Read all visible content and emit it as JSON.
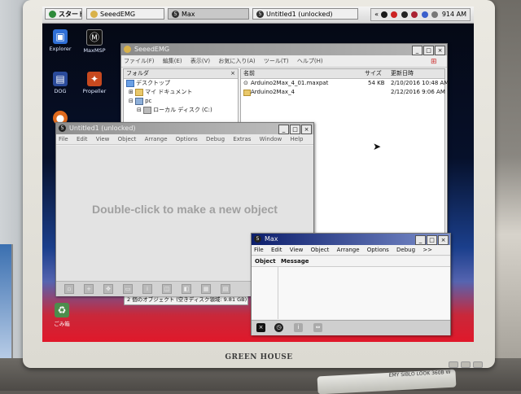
{
  "taskbar": {
    "start_label": "スタート",
    "items": [
      {
        "label": "SeeedEMG"
      },
      {
        "label": "Max"
      },
      {
        "label": "Untitled1 (unlocked)"
      }
    ],
    "tray_chevron": "«",
    "clock": "914 AM"
  },
  "desktop_icons": [
    {
      "label": "Explorer",
      "icon": "explorer-icon"
    },
    {
      "label": "MaxMSP",
      "icon": "max-icon"
    },
    {
      "label": "DOG",
      "icon": "app-icon"
    },
    {
      "label": "Propeller",
      "icon": "propeller-icon"
    },
    {
      "label": "ごみ箱",
      "icon": "recycle-bin-icon"
    }
  ],
  "explorer": {
    "title": "SeeedEMG",
    "menu": [
      "ファイル(F)",
      "編集(E)",
      "表示(V)",
      "お気に入り(A)",
      "ツール(T)",
      "ヘルプ(H)"
    ],
    "tree_header": "フォルダ",
    "tree_close": "×",
    "tree": [
      {
        "label": "デスクトップ",
        "level": 0
      },
      {
        "label": "マイ ドキュメント",
        "level": 1
      },
      {
        "label": "pc",
        "level": 1
      },
      {
        "label": "ローカル ディスク (C:)",
        "level": 2
      }
    ],
    "columns": {
      "name": "名前",
      "size": "サイズ",
      "date": "更新日時"
    },
    "files": [
      {
        "name": "Arduino2Max_4_01.maxpat",
        "size": "54 KB",
        "date": "2/10/2016 10:48 AM"
      },
      {
        "name": "Arduino2Max_4",
        "size": "",
        "date": "2/12/2016 9:06 AM"
      }
    ]
  },
  "status_bar": "2 個のオブジェクト (空きディスク領域: 9.81 GB)",
  "patcher": {
    "title": "Untitled1 (unlocked)",
    "menu": [
      "File",
      "Edit",
      "View",
      "Object",
      "Arrange",
      "Options",
      "Debug",
      "Extras",
      "Window",
      "Help"
    ],
    "hint": "Double-click to make a new object"
  },
  "max_console": {
    "title": "Max",
    "menu": [
      "File",
      "Edit",
      "View",
      "Object",
      "Arrange",
      "Options",
      "Debug",
      ">>"
    ],
    "col_object": "Object",
    "col_message": "Message"
  },
  "monitor": {
    "brand": "GREEN HOUSE"
  },
  "keyboard": {
    "label": "EMY SIBLO LOOK 360B W"
  },
  "colors": {
    "max_titlebar": "#0c1e6c",
    "desktop_red": "#e0182a",
    "desktop_blue": "#1b3f8c"
  }
}
